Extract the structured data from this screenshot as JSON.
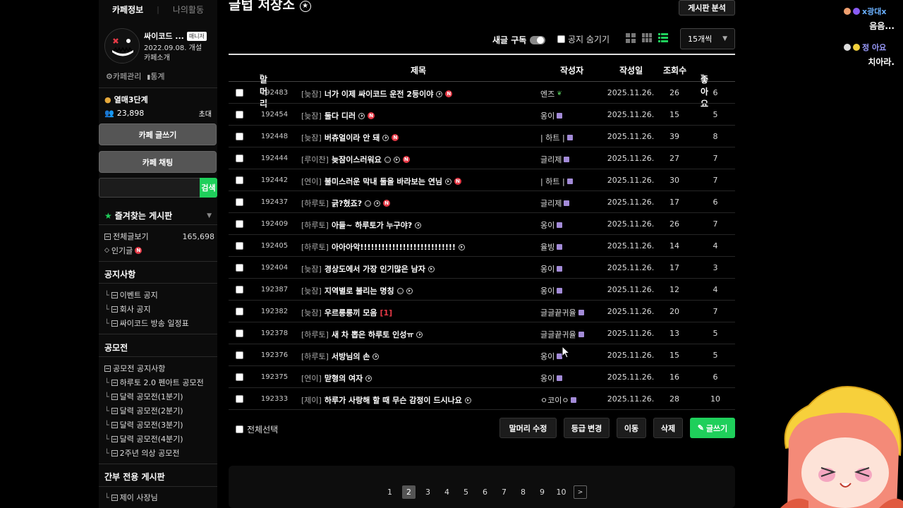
{
  "sidebar": {
    "tabs": [
      {
        "label": "카페정보"
      },
      {
        "label": "나의활동"
      }
    ],
    "cafe": {
      "name": "싸이코드 ...",
      "badge": "매니저",
      "date": "2022.09.08. 개설",
      "intro": "카페소개"
    },
    "links": {
      "manage": "카페관리",
      "stats": "통계"
    },
    "level": "열매3단계",
    "members": "23,898",
    "invite": "초대",
    "write_btn": "카페 글쓰기",
    "chat_btn": "카페 채팅",
    "search_btn": "검색",
    "fav_title": "즐겨찾는 게시판",
    "all_posts": {
      "label": "전체글보기",
      "count": "165,698"
    },
    "popular": "인기글",
    "notice_title": "공지사항",
    "notices": [
      "이벤트 공지",
      "회사 공지",
      "싸이코드 방송 일정표"
    ],
    "contest_title": "공모전",
    "contests": [
      "공모전 공지사항",
      "하루토 2.0 펜아트 공모전",
      "달력 공모전(1분기)",
      "달력 공모전(2분기)",
      "달력 공모전(3분기)",
      "달력 공모전(4분기)",
      "2주년 의상 공모전"
    ],
    "staff_title": "간부 전용 게시판",
    "staff": [
      "제이 사장님"
    ]
  },
  "main": {
    "title": "글텁 저장소",
    "analysis_btn": "게시판 분석",
    "subscribe": "새글 구독",
    "hide_notice": "공지 숨기기",
    "per_page": "15개씩",
    "headers": {
      "prefix": "말머리",
      "title": "제목",
      "author": "작성자",
      "date": "작성일",
      "views": "조회수",
      "likes": "좋아요"
    },
    "rows": [
      {
        "no": "192483",
        "head": "[늦잠]",
        "title": "너가 이제 싸이코드 운전 2등이야",
        "author": "엔즈",
        "date": "2025.11.26.",
        "views": "26",
        "likes": "6"
      },
      {
        "no": "192454",
        "head": "[늦잠]",
        "title": "둘다 디러",
        "author": "옹이",
        "date": "2025.11.26.",
        "views": "15",
        "likes": "5"
      },
      {
        "no": "192448",
        "head": "[늦잠]",
        "title": "버츄얼이라 안 돼",
        "author": "| 하트 |",
        "date": "2025.11.26.",
        "views": "39",
        "likes": "8"
      },
      {
        "no": "192444",
        "head": "[루이찬]",
        "title": "늦잠이스러워요",
        "author": "글리제",
        "date": "2025.11.26.",
        "views": "27",
        "likes": "7"
      },
      {
        "no": "192442",
        "head": "[연이]",
        "title": "불미스러운 막내 둘을 바라보는 연님",
        "author": "| 하트 |",
        "date": "2025.11.26.",
        "views": "30",
        "likes": "7"
      },
      {
        "no": "192437",
        "head": "[하루토]",
        "title": "긁?혔죠?",
        "author": "글리제",
        "date": "2025.11.26.",
        "views": "17",
        "likes": "6"
      },
      {
        "no": "192409",
        "head": "[하루토]",
        "title": "아들~ 하루토가 누구야?",
        "author": "옹이",
        "date": "2025.11.26.",
        "views": "26",
        "likes": "7"
      },
      {
        "no": "192405",
        "head": "[하루토]",
        "title": "아아아악!!!!!!!!!!!!!!!!!!!!!!!!!!!",
        "author": "율빙",
        "date": "2025.11.26.",
        "views": "14",
        "likes": "4"
      },
      {
        "no": "192404",
        "head": "[늦잠]",
        "title": "경상도에서 가장 인기많은 남자",
        "author": "옹이",
        "date": "2025.11.26.",
        "views": "17",
        "likes": "3"
      },
      {
        "no": "192387",
        "head": "[늦잠]",
        "title": "지역별로 불리는 명칭",
        "author": "옹이",
        "date": "2025.11.26.",
        "views": "12",
        "likes": "4"
      },
      {
        "no": "192382",
        "head": "[늦잠]",
        "title": "우르릉릉끼 모음",
        "comments": "[1]",
        "author": "글글끝귀율",
        "date": "2025.11.26.",
        "views": "20",
        "likes": "7"
      },
      {
        "no": "192378",
        "head": "[하루토]",
        "title": "새 차 뽑은 하루토 인성ㅠ",
        "author": "글글끝귀율",
        "date": "2025.11.26.",
        "views": "13",
        "likes": "5"
      },
      {
        "no": "192376",
        "head": "[하루토]",
        "title": "서방님의 손",
        "author": "옹이",
        "date": "2025.11.26.",
        "views": "15",
        "likes": "5"
      },
      {
        "no": "192375",
        "head": "[연이]",
        "title": "맏형의 여자",
        "author": "옹이",
        "date": "2025.11.26.",
        "views": "16",
        "likes": "6"
      },
      {
        "no": "192333",
        "head": "[제이]",
        "title": "하루가 사랑해 할 때 무슨 감정이 드시나요",
        "author": "ㅇ코이ㅇ",
        "date": "2025.11.26.",
        "views": "28",
        "likes": "10"
      }
    ],
    "select_all": "전체선택",
    "actions": {
      "edit_prefix": "말머리 수정",
      "change_grade": "등급 변경",
      "move": "이동",
      "delete": "삭제",
      "write": "글쓰기"
    },
    "pages": [
      "1",
      "2",
      "3",
      "4",
      "5",
      "6",
      "7",
      "8",
      "9",
      "10"
    ],
    "current_page": "2"
  },
  "overlay": {
    "chat": [
      {
        "user": "x광대x",
        "msg": "음음..."
      },
      {
        "user": "정 아요",
        "msg": "치아라."
      }
    ]
  },
  "colors": {
    "accent_green": "#1fcf5b",
    "new_red": "#e53946",
    "grade_purple": "#a38bd8"
  }
}
